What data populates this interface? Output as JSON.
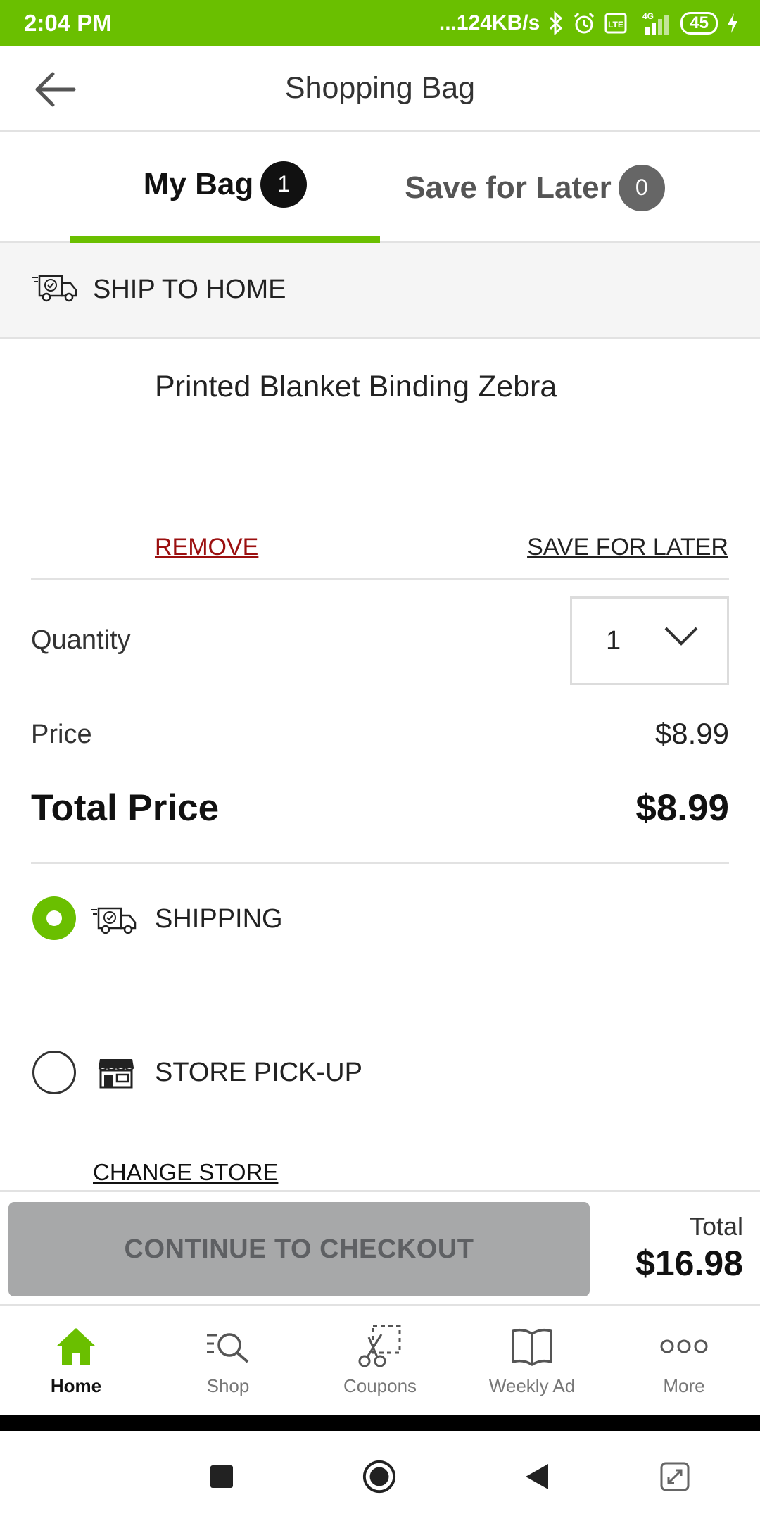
{
  "status_bar": {
    "time": "2:04 PM",
    "network_speed": "...124KB/s",
    "network_type": "4G",
    "battery_level": "45"
  },
  "header": {
    "title": "Shopping Bag",
    "back_icon": "arrow-left-icon"
  },
  "tabs": [
    {
      "label": "My Bag",
      "count": "1",
      "active": true
    },
    {
      "label": "Save for Later",
      "count": "0",
      "active": false
    }
  ],
  "fulfillment_header": {
    "label": "SHIP TO HOME",
    "icon": "delivery-truck-icon"
  },
  "product": {
    "name": "Printed Blanket Binding Zebra",
    "remove_label": "REMOVE",
    "save_for_later_label": "SAVE FOR LATER",
    "quantity_label": "Quantity",
    "quantity_value": "1",
    "price_label": "Price",
    "price_value": "$8.99",
    "total_label": "Total Price",
    "total_value": "$8.99"
  },
  "delivery_options": {
    "shipping_label": "SHIPPING",
    "shipping_selected": true,
    "pickup_label": "STORE PICK-UP",
    "pickup_selected": false,
    "change_store_label": "CHANGE STORE"
  },
  "checkout": {
    "button_label": "CONTINUE TO CHECKOUT",
    "total_label": "Total",
    "total_value": "$16.98"
  },
  "bottom_nav": [
    {
      "label": "Home",
      "icon": "home-icon",
      "active": true
    },
    {
      "label": "Shop",
      "icon": "search-list-icon",
      "active": false
    },
    {
      "label": "Coupons",
      "icon": "coupon-scissors-icon",
      "active": false
    },
    {
      "label": "Weekly Ad",
      "icon": "book-icon",
      "active": false
    },
    {
      "label": "More",
      "icon": "more-dots-icon",
      "active": false
    }
  ],
  "colors": {
    "accent": "#6abf00",
    "remove_link": "#9b0f0f",
    "checkout_disabled": "#a7a8a9"
  }
}
